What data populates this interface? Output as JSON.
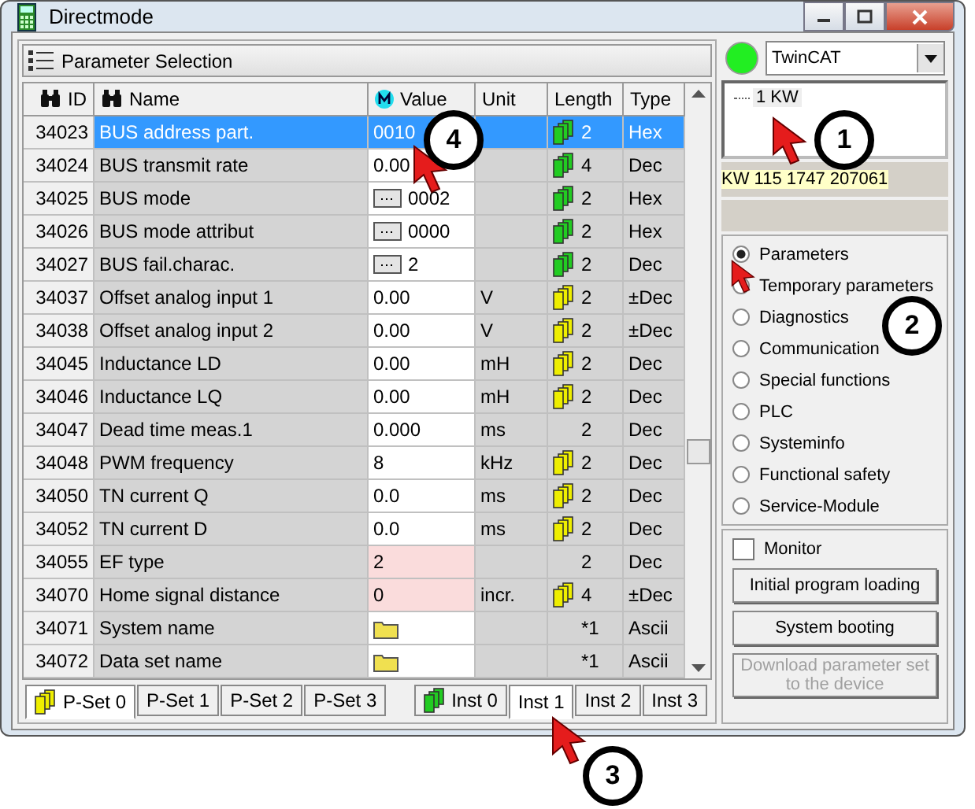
{
  "window": {
    "title": "Directmode"
  },
  "panel": {
    "title": "Parameter Selection"
  },
  "table": {
    "columns": [
      {
        "label": "ID",
        "kind": "search"
      },
      {
        "label": "Name",
        "kind": "search"
      },
      {
        "label": "Value",
        "kind": "marker"
      },
      {
        "label": "Unit",
        "kind": "plain"
      },
      {
        "label": "Length",
        "kind": "plain"
      },
      {
        "label": "Type",
        "kind": "plain"
      }
    ],
    "rows": [
      {
        "id": "34023",
        "name": "BUS address part.",
        "value": "0010",
        "kind": "text",
        "flagged": false,
        "unit": "",
        "color": "#22cc22",
        "length": "2",
        "type": "Hex",
        "selected": true
      },
      {
        "id": "34024",
        "name": "BUS transmit rate",
        "value": "0.00",
        "kind": "text",
        "flagged": false,
        "unit": "",
        "color": "#22cc22",
        "length": "4",
        "type": "Dec",
        "selected": false
      },
      {
        "id": "34025",
        "name": "BUS mode",
        "value": "0002",
        "kind": "button",
        "flagged": false,
        "unit": "",
        "color": "#22cc22",
        "length": "2",
        "type": "Hex",
        "selected": false
      },
      {
        "id": "34026",
        "name": "BUS mode attribut",
        "value": "0000",
        "kind": "button",
        "flagged": false,
        "unit": "",
        "color": "#22cc22",
        "length": "2",
        "type": "Hex",
        "selected": false
      },
      {
        "id": "34027",
        "name": "BUS fail.charac.",
        "value": "2",
        "kind": "button",
        "flagged": false,
        "unit": "",
        "color": "#22cc22",
        "length": "2",
        "type": "Dec",
        "selected": false
      },
      {
        "id": "34037",
        "name": "Offset analog input 1",
        "value": "0.00",
        "kind": "text",
        "flagged": false,
        "unit": "V",
        "color": "#eeee00",
        "length": "2",
        "type": "±Dec",
        "selected": false
      },
      {
        "id": "34038",
        "name": "Offset analog input 2",
        "value": "0.00",
        "kind": "text",
        "flagged": false,
        "unit": "V",
        "color": "#eeee00",
        "length": "2",
        "type": "±Dec",
        "selected": false
      },
      {
        "id": "34045",
        "name": "Inductance LD",
        "value": "0.00",
        "kind": "text",
        "flagged": false,
        "unit": "mH",
        "color": "#eeee00",
        "length": "2",
        "type": "Dec",
        "selected": false
      },
      {
        "id": "34046",
        "name": "Inductance LQ",
        "value": "0.00",
        "kind": "text",
        "flagged": false,
        "unit": "mH",
        "color": "#eeee00",
        "length": "2",
        "type": "Dec",
        "selected": false
      },
      {
        "id": "34047",
        "name": "Dead time meas.1",
        "value": "0.000",
        "kind": "text",
        "flagged": false,
        "unit": "ms",
        "length": "2",
        "type": "Dec",
        "selected": false
      },
      {
        "id": "34048",
        "name": "PWM frequency",
        "value": "8",
        "kind": "text",
        "flagged": false,
        "unit": "kHz",
        "color": "#eeee00",
        "length": "2",
        "type": "Dec",
        "selected": false
      },
      {
        "id": "34050",
        "name": "TN current Q",
        "value": "0.0",
        "kind": "text",
        "flagged": false,
        "unit": "ms",
        "color": "#eeee00",
        "length": "2",
        "type": "Dec",
        "selected": false
      },
      {
        "id": "34052",
        "name": "TN current D",
        "value": "0.0",
        "kind": "text",
        "flagged": false,
        "unit": "ms",
        "color": "#eeee00",
        "length": "2",
        "type": "Dec",
        "selected": false
      },
      {
        "id": "34055",
        "name": "EF type",
        "value": "2",
        "kind": "text",
        "flagged": true,
        "unit": "",
        "length": "2",
        "type": "Dec",
        "selected": false
      },
      {
        "id": "34070",
        "name": "Home signal distance",
        "value": "0",
        "kind": "text",
        "flagged": true,
        "unit": "incr.",
        "color": "#eeee00",
        "length": "4",
        "type": "±Dec",
        "selected": false
      },
      {
        "id": "34071",
        "name": "System name",
        "kind": "folder",
        "flagged": false,
        "unit": "",
        "length": "*1",
        "type": "Ascii",
        "selected": false
      },
      {
        "id": "34072",
        "name": "Data set name",
        "kind": "folder",
        "flagged": false,
        "unit": "",
        "length": "*1",
        "type": "Ascii",
        "selected": false
      }
    ]
  },
  "pset_tabs": [
    {
      "label": "P-Set 0",
      "selected": true
    },
    {
      "label": "P-Set 1",
      "selected": false
    },
    {
      "label": "P-Set 2",
      "selected": false
    },
    {
      "label": "P-Set 3",
      "selected": false
    }
  ],
  "inst_tabs": [
    {
      "label": "Inst 0",
      "selected": false
    },
    {
      "label": "Inst 1",
      "selected": true
    },
    {
      "label": "Inst 2",
      "selected": false
    },
    {
      "label": "Inst 3",
      "selected": false
    }
  ],
  "device": {
    "online": true,
    "combo": "TwinCAT",
    "tree_item": "1 KW",
    "info": "KW  115 1747 207061"
  },
  "options": [
    {
      "label": "Parameters",
      "selected": true
    },
    {
      "label": "Temporary parameters",
      "selected": false
    },
    {
      "label": "Diagnostics",
      "selected": false
    },
    {
      "label": "Communication",
      "selected": false
    },
    {
      "label": "Special functions",
      "selected": false
    },
    {
      "label": "PLC",
      "selected": false
    },
    {
      "label": "Systeminfo",
      "selected": false
    },
    {
      "label": "Functional safety",
      "selected": false
    },
    {
      "label": "Service-Module",
      "selected": false
    }
  ],
  "monitor": {
    "label": "Monitor",
    "checked": false
  },
  "buttons": [
    {
      "label": "Initial program loading",
      "disabled": false
    },
    {
      "label": "System booting",
      "disabled": false
    },
    {
      "label": "Download parameter set to the device",
      "disabled": true
    }
  ],
  "callouts": [
    "1",
    "2",
    "3",
    "4"
  ]
}
